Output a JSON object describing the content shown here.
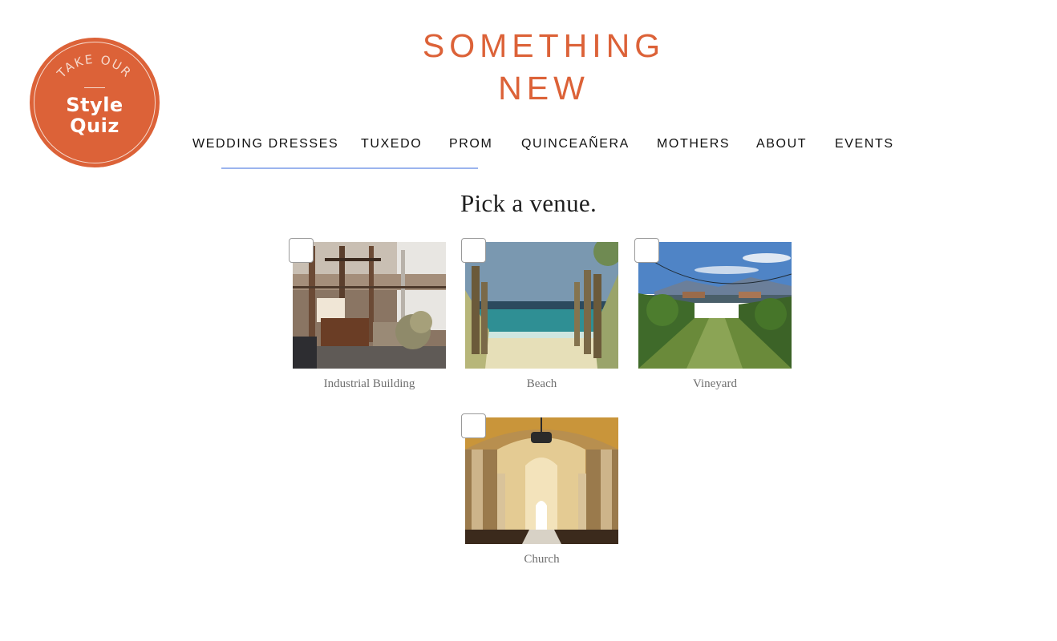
{
  "badge": {
    "top_text": "TAKE OUR",
    "line1": "Style",
    "line2": "Quiz"
  },
  "logo": {
    "line1": "SOMETHING",
    "line2": "NEW"
  },
  "nav": {
    "items": [
      {
        "label": "WEDDING DRESSES"
      },
      {
        "label": "TUXEDO"
      },
      {
        "label": "PROM"
      },
      {
        "label": "QUINCEAÑERA"
      },
      {
        "label": "MOTHERS"
      },
      {
        "label": "ABOUT"
      },
      {
        "label": "EVENTS"
      }
    ],
    "active_underline_color": "#9bb4ee"
  },
  "main": {
    "heading": "Pick a venue.",
    "options": [
      {
        "label": "Industrial Building",
        "checked": false
      },
      {
        "label": "Beach",
        "checked": false
      },
      {
        "label": "Vineyard",
        "checked": false
      },
      {
        "label": "Church",
        "checked": false
      }
    ]
  },
  "colors": {
    "brand": "#dc6238",
    "text": "#111111",
    "caption": "#6f6f6f"
  }
}
